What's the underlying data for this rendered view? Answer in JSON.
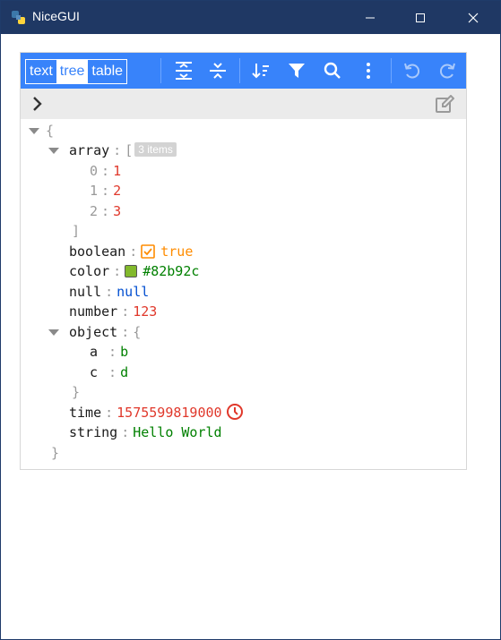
{
  "window": {
    "title": "NiceGUI"
  },
  "editor": {
    "modes": [
      {
        "label": "text",
        "active": false
      },
      {
        "label": "tree",
        "active": true
      },
      {
        "label": "table",
        "active": false
      }
    ],
    "tree": {
      "root_open": "{",
      "root_close": "}",
      "array": {
        "key": "array",
        "open": "[",
        "close": "]",
        "badge": "3 items",
        "items": [
          {
            "index": "0",
            "value": "1"
          },
          {
            "index": "1",
            "value": "2"
          },
          {
            "index": "2",
            "value": "3"
          }
        ]
      },
      "boolean": {
        "key": "boolean",
        "value": "true"
      },
      "color": {
        "key": "color",
        "value": "#82b92c"
      },
      "null": {
        "key": "null",
        "value": "null"
      },
      "number": {
        "key": "number",
        "value": "123"
      },
      "object": {
        "key": "object",
        "open": "{",
        "close": "}",
        "entries": [
          {
            "key": "a",
            "value": "b"
          },
          {
            "key": "c",
            "value": "d"
          }
        ]
      },
      "time": {
        "key": "time",
        "value": "1575599819000"
      },
      "string": {
        "key": "string",
        "value": "Hello World"
      }
    },
    "icons": {
      "accent": "#3883fa",
      "number": "#e0382b",
      "string": "#008000",
      "null": "#004ed0",
      "boolean": "#ff8c00"
    }
  }
}
